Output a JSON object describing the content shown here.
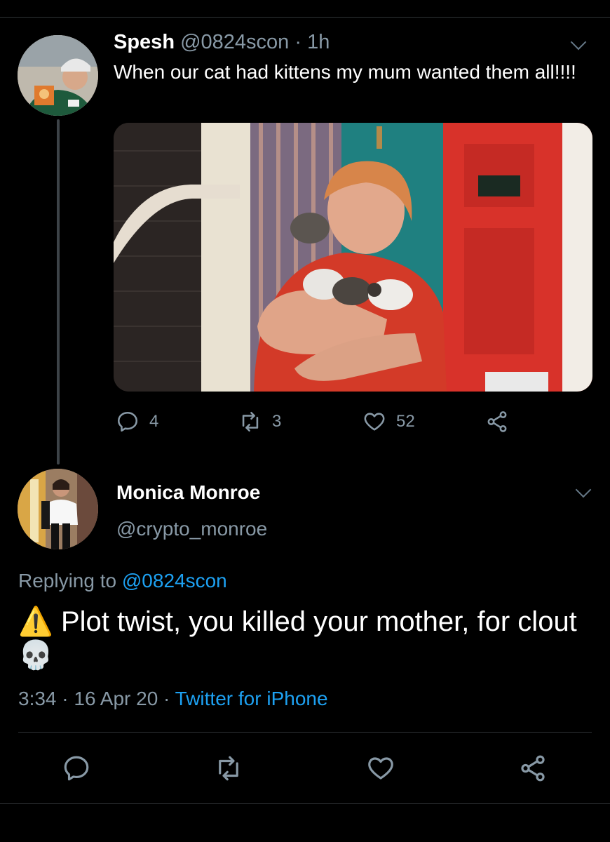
{
  "tweet": {
    "author_name": "Spesh",
    "author_handle": "@0824scon",
    "separator": "·",
    "time_ago": "1h",
    "text": "When our cat had kittens my mum wanted them all!!!!",
    "counts": {
      "replies": "4",
      "retweets": "3",
      "likes": "52"
    }
  },
  "reply": {
    "author_name": "Monica Monroe",
    "author_handle": "@crypto_monroe",
    "replying_prefix": "Replying to",
    "replying_handle": "@0824scon",
    "text_warning": "⚠️",
    "text": "Plot twist, you killed your mother, for clout",
    "text_skull": "💀",
    "time": "3:34",
    "date": "16 Apr 20",
    "source": "Twitter for iPhone",
    "sep": "·"
  },
  "icons": {
    "reply": "reply-icon",
    "retweet": "retweet-icon",
    "like": "heart-icon",
    "share": "share-icon",
    "menu": "chevron-down-icon"
  },
  "colors": {
    "background": "#000000",
    "accent": "#1da1f2",
    "muted": "#8899a6"
  }
}
